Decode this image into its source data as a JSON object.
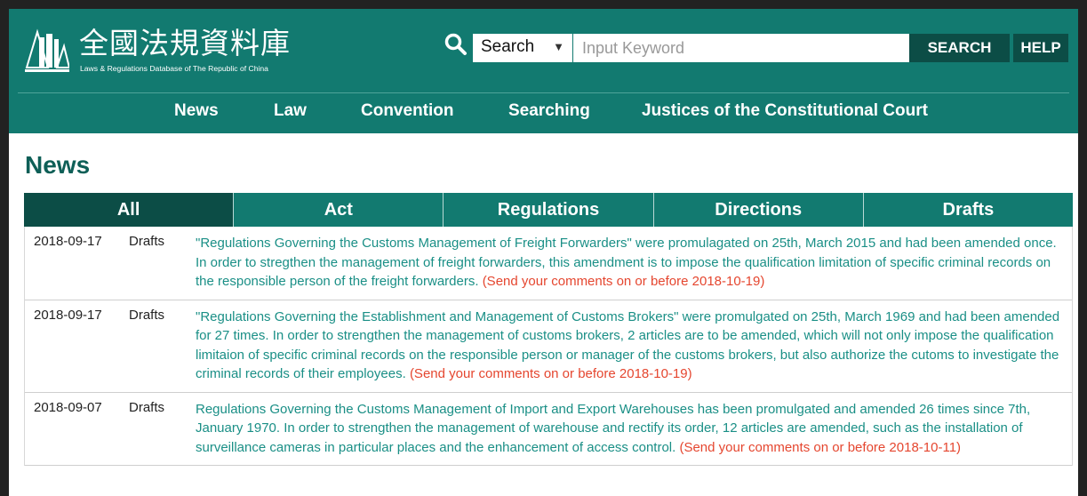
{
  "header": {
    "title": "全國法規資料庫",
    "subtitle": "Laws & Regulations Database of The Republic of China",
    "search_select": "Search",
    "search_placeholder": "Input Keyword",
    "search_button": "SEARCH",
    "help_button": "HELP"
  },
  "nav": [
    "News",
    "Law",
    "Convention",
    "Searching",
    "Justices of the Constitutional Court"
  ],
  "page_title": "News",
  "tabs": [
    "All",
    "Act",
    "Regulations",
    "Directions",
    "Drafts"
  ],
  "news": [
    {
      "date": "2018-09-17",
      "category": "Drafts",
      "text": "\"Regulations Governing the Customs Management of Freight Forwarders\" were promulagated on 25th, March 2015 and had been amended once. In order to stregthen the management of freight forwarders, this amendment is to impose the qualification limitation of specific criminal records on the responsible person of the freight forwarders.",
      "note": "(Send your comments on or before 2018-10-19)"
    },
    {
      "date": "2018-09-17",
      "category": "Drafts",
      "text": "\"Regulations Governing the Establishment and Management of Customs Brokers\" were promulgated on 25th, March 1969 and had been amended for 27 times. In order to strengthen the management of customs brokers, 2 articles are to be amended, which will not only impose the qualification limitaion of specific criminal records on the responsible person or manager of the customs brokers, but also authorize the cutoms to investigate the criminal records of their employees.",
      "note": "(Send your comments on or before 2018-10-19)"
    },
    {
      "date": "2018-09-07",
      "category": "Drafts",
      "text": "Regulations Governing the Customs Management of Import and Export Warehouses has been promulgated and amended 26 times since 7th, January 1970. In order to strengthen the management of warehouse and rectify its order, 12 articles are amended, such as the installation of surveillance cameras in particular places and the enhancement of access control.",
      "note": "(Send your comments on or before 2018-10-11)"
    }
  ],
  "colors": {
    "header_bg": "#127a70",
    "dark_accent": "#0c4d46",
    "link": "#1a8f86",
    "note": "#e5462f"
  },
  "icons": [
    "logo-icon",
    "search-icon",
    "caret-down-icon"
  ]
}
